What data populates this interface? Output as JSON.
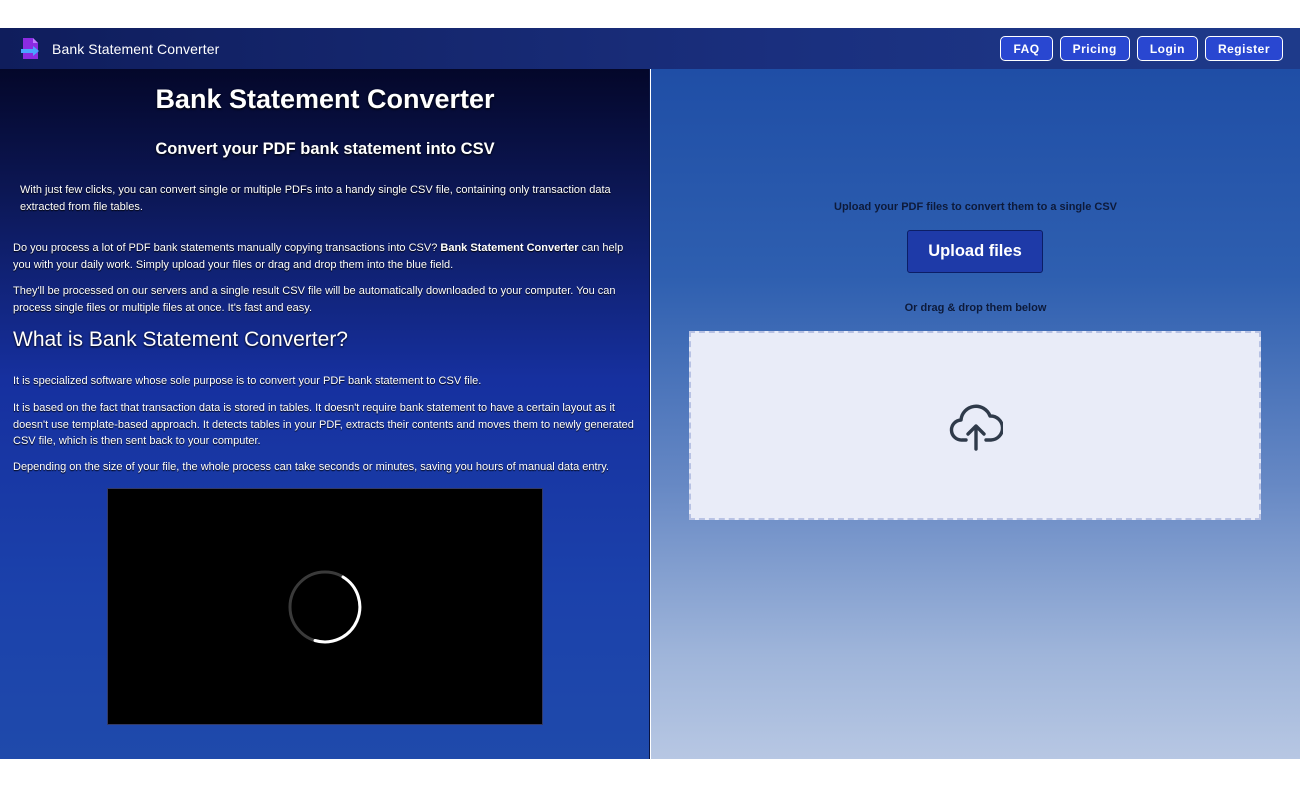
{
  "brand": {
    "title": "Bank Statement Converter",
    "logo_icon": "document-arrow-icon"
  },
  "nav": {
    "faq": "FAQ",
    "pricing": "Pricing",
    "login": "Login",
    "register": "Register"
  },
  "left": {
    "heading": "Bank Statement Converter",
    "subheading": "Convert your PDF bank statement into CSV",
    "intro": "With just few clicks, you can convert single or multiple PDFs into a handy single CSV file, containing only transaction data extracted from file tables.",
    "para1_before": "Do you process a lot of PDF bank statements manually copying transactions into CSV? ",
    "para1_bold": "Bank Statement Converter",
    "para1_after": " can help you with your daily work. Simply upload your files or drag and drop them into the blue field.",
    "para2": "They'll be processed on our servers and a single result CSV file will be automatically downloaded to your computer. You can process single files or multiple files at once. It's fast and easy.",
    "what_heading": "What is Bank Statement Converter?",
    "para3": "It is specialized software whose sole purpose is to convert your PDF bank statement to CSV file.",
    "para4": "It is based on the fact that transaction data is stored in tables. It doesn't require bank statement to have a certain layout as it doesn't use template-based approach. It detects tables in your PDF, extracts their contents and moves them to newly generated CSV file, which is then sent back to your computer.",
    "para5": "Depending on the size of your file, the whole process can take seconds or minutes, saving you hours of manual data entry.",
    "video_icon": "loading-spinner-icon"
  },
  "right": {
    "upload_caption": "Upload your PDF files to convert them to a single CSV",
    "upload_button": "Upload files",
    "drag_caption": "Or drag & drop them below",
    "dropzone_icon": "cloud-upload-icon"
  },
  "colors": {
    "nav_bg": "#1a2f7e",
    "button_bg": "#2947d1",
    "upload_button_bg": "#1e3aa8",
    "dropzone_bg": "#e9ecf8"
  }
}
